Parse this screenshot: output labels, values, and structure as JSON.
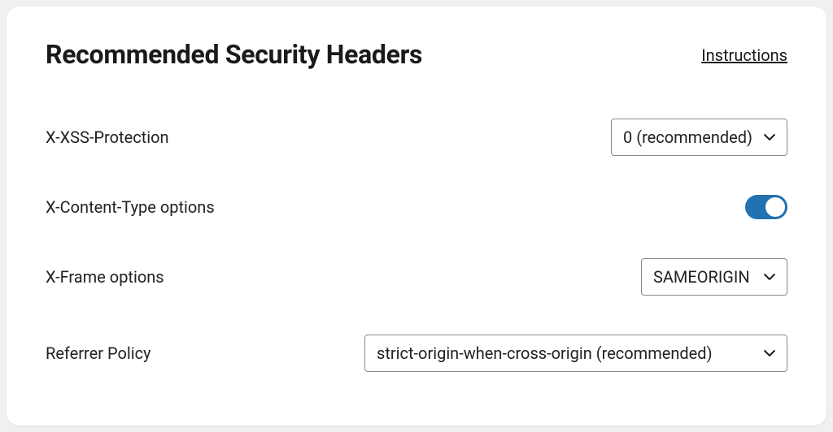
{
  "header": {
    "title": "Recommended Security Headers",
    "instructions_label": "Instructions"
  },
  "rows": {
    "xss": {
      "label": "X-XSS-Protection",
      "value": "0 (recommended)"
    },
    "content_type": {
      "label": "X-Content-Type options",
      "toggle_on": true
    },
    "frame": {
      "label": "X-Frame options",
      "value": "SAMEORIGIN"
    },
    "referrer": {
      "label": "Referrer Policy",
      "value": "strict-origin-when-cross-origin (recommended)"
    }
  }
}
